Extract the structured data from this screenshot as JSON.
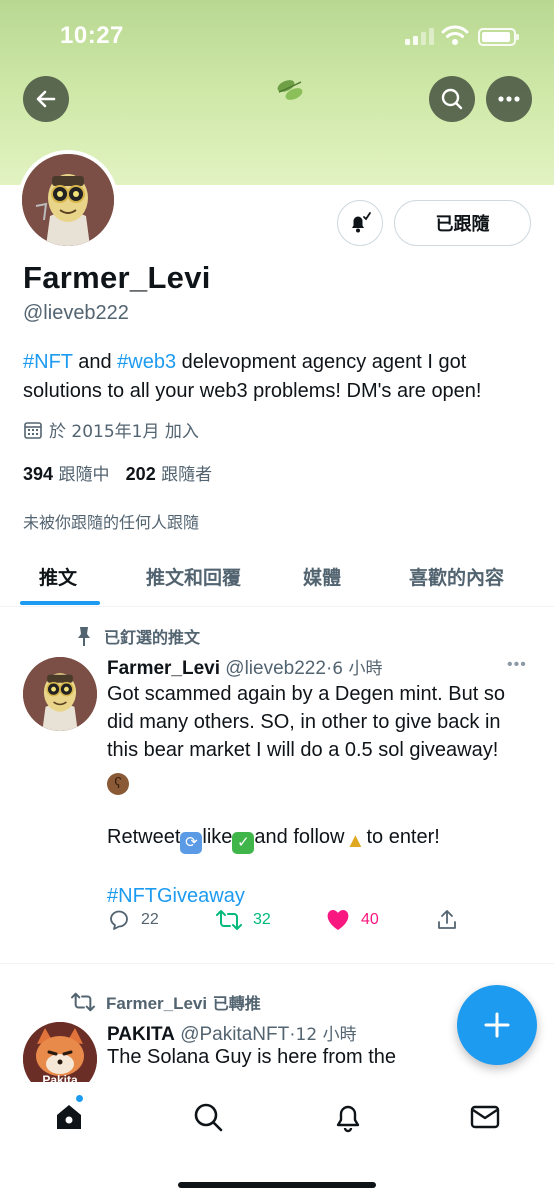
{
  "status_bar": {
    "time": "10:27"
  },
  "header": {
    "back_icon": "arrow-left-icon",
    "logo_icon": "leaf-icon",
    "search_icon": "search-icon",
    "more_icon": "ellipsis-icon"
  },
  "profile": {
    "name": "Farmer_Levi",
    "handle": "@lieveb222",
    "follow_label": "已跟隨",
    "bio": {
      "tag1": "#NFT",
      "and": " and ",
      "tag2": "#web3",
      "text_line1": " delevopment agency agent I got",
      "text_line2": "solutions to all your web3 problems! DM's are open!"
    },
    "joined": "於 2015年1月 加入",
    "following_count": "394",
    "following_label": "跟隨中",
    "followers_count": "202",
    "followers_label": "跟隨者",
    "not_followed_text": "未被你跟隨的任何人跟隨"
  },
  "tabs": [
    {
      "label": "推文",
      "active": true
    },
    {
      "label": "推文和回覆"
    },
    {
      "label": "媒體"
    },
    {
      "label": "喜歡的內容"
    }
  ],
  "pinned_tweet": {
    "context": "已釘選的推文",
    "author": "Farmer_Levi",
    "handle": "@lieveb222",
    "sep": "·",
    "time": "6 小時",
    "lines": [
      "Got scammed again by a Degen mint. But so",
      "did many others. SO, in other to give back in",
      "this bear market I will do a 0.5 sol giveaway!"
    ],
    "retweet_word": "Retweet",
    "like_word": "like",
    "follow_word": "and follow",
    "enter_word": "to enter!",
    "hashtag": "#NFTGiveaway",
    "replies": "22",
    "retweets": "32",
    "likes": "40"
  },
  "retweet_item": {
    "context_name": "Farmer_Levi",
    "context_suffix": "已轉推",
    "author": "PAKITA",
    "handle": "@PakitaNFT",
    "sep": "·",
    "time": "12 小時",
    "text": "The Solana Guy is here from the",
    "avatar_text": "Pakita"
  },
  "colors": {
    "accent": "#1d9bf0",
    "like": "#f91880",
    "retweet": "#00ba7c",
    "banner": "#cfe8a8"
  },
  "bottom_nav": [
    "home-icon",
    "search-icon",
    "bell-icon",
    "mail-icon"
  ]
}
